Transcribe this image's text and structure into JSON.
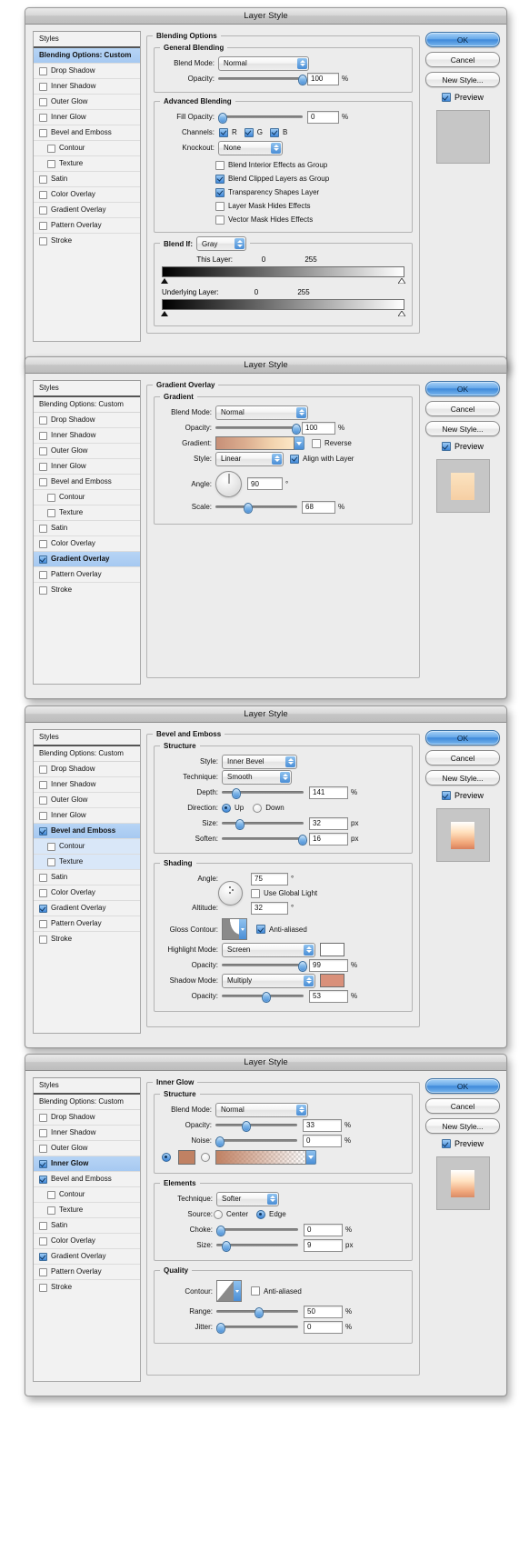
{
  "dialog_title": "Layer Style",
  "buttons": {
    "ok": "OK",
    "cancel": "Cancel",
    "new_style": "New Style...",
    "preview": "Preview"
  },
  "styles_header": "Styles",
  "styles_items": [
    "Blending Options: Custom",
    "Drop Shadow",
    "Inner Shadow",
    "Outer Glow",
    "Inner Glow",
    "Bevel and Emboss",
    "Contour",
    "Texture",
    "Satin",
    "Color Overlay",
    "Gradient Overlay",
    "Pattern Overlay",
    "Stroke"
  ],
  "colors": {
    "selection_blue": "#a9cbf2",
    "accent_blue": "#4a8ed6",
    "gradient_start": "#c79078",
    "gradient_end": "#fce7c6",
    "shadow_swatch": "#d9907a",
    "highlight_swatch": "#ffffff",
    "inner_glow_swatch": "#c08163",
    "preview_bg": "#c6c6c6"
  },
  "panel1": {
    "title": "Layer Style",
    "selected_style": "Blending Options: Custom",
    "group": "Blending Options",
    "general": {
      "legend": "General Blending",
      "blend_mode_label": "Blend Mode:",
      "blend_mode_value": "Normal",
      "opacity_label": "Opacity:",
      "opacity_value": "100",
      "opacity_unit": "%",
      "opacity_pct": 100
    },
    "advanced": {
      "legend": "Advanced Blending",
      "fill_opacity_label": "Fill Opacity:",
      "fill_opacity_value": "0",
      "fill_opacity_unit": "%",
      "fill_opacity_pct": 0,
      "channels_label": "Channels:",
      "channels": [
        {
          "label": "R",
          "checked": true
        },
        {
          "label": "G",
          "checked": true
        },
        {
          "label": "B",
          "checked": true
        }
      ],
      "knockout_label": "Knockout:",
      "knockout_value": "None",
      "checks": [
        {
          "label": "Blend Interior Effects as Group",
          "checked": false
        },
        {
          "label": "Blend Clipped Layers as Group",
          "checked": true
        },
        {
          "label": "Transparency Shapes Layer",
          "checked": true
        },
        {
          "label": "Layer Mask Hides Effects",
          "checked": false
        },
        {
          "label": "Vector Mask Hides Effects",
          "checked": false
        }
      ]
    },
    "blend_if": {
      "legend_label": "Blend If:",
      "channel_value": "Gray",
      "this_layer_label": "This Layer:",
      "this_layer_min": "0",
      "this_layer_max": "255",
      "underlying_label": "Underlying Layer:",
      "underlying_min": "0",
      "underlying_max": "255"
    }
  },
  "panel2": {
    "title": "Layer Style",
    "selected_style": "Gradient Overlay",
    "group": "Gradient Overlay",
    "gradient": {
      "legend": "Gradient",
      "blend_mode_label": "Blend Mode:",
      "blend_mode_value": "Normal",
      "opacity_label": "Opacity:",
      "opacity_value": "100",
      "opacity_unit": "%",
      "opacity_pct": 100,
      "gradient_label": "Gradient:",
      "reverse_label": "Reverse",
      "reverse_checked": false,
      "style_label": "Style:",
      "style_value": "Linear",
      "align_label": "Align with Layer",
      "align_checked": true,
      "angle_label": "Angle:",
      "angle_value": "90",
      "angle_unit": "°",
      "scale_label": "Scale:",
      "scale_value": "68",
      "scale_unit": "%",
      "scale_pct": 68
    }
  },
  "panel3": {
    "title": "Layer Style",
    "selected_style": "Bevel and Emboss",
    "group": "Bevel and Emboss",
    "structure": {
      "legend": "Structure",
      "style_label": "Style:",
      "style_value": "Inner Bevel",
      "technique_label": "Technique:",
      "technique_value": "Smooth",
      "depth_label": "Depth:",
      "depth_value": "141",
      "depth_unit": "%",
      "depth_pct": 14,
      "direction_label": "Direction:",
      "direction_up": "Up",
      "direction_down": "Down",
      "direction_selected": "Up",
      "size_label": "Size:",
      "size_value": "32",
      "size_unit": "px",
      "size_pct": 18,
      "soften_label": "Soften:",
      "soften_value": "16",
      "soften_unit": "px",
      "soften_pct": 95
    },
    "shading": {
      "legend": "Shading",
      "angle_label": "Angle:",
      "angle_value": "75",
      "angle_unit": "°",
      "use_global_light_label": "Use Global Light",
      "use_global_light_checked": false,
      "altitude_label": "Altitude:",
      "altitude_value": "32",
      "altitude_unit": "°",
      "gloss_contour_label": "Gloss Contour:",
      "anti_aliased_label": "Anti-aliased",
      "anti_aliased_checked": true,
      "highlight_mode_label": "Highlight Mode:",
      "highlight_mode_value": "Screen",
      "highlight_opacity_label": "Opacity:",
      "highlight_opacity_value": "99",
      "highlight_opacity_unit": "%",
      "highlight_opacity_pct": 96,
      "shadow_mode_label": "Shadow Mode:",
      "shadow_mode_value": "Multiply",
      "shadow_opacity_label": "Opacity:",
      "shadow_opacity_value": "53",
      "shadow_opacity_unit": "%",
      "shadow_opacity_pct": 52
    }
  },
  "panel4": {
    "title": "Layer Style",
    "selected_style": "Inner Glow",
    "group": "Inner Glow",
    "structure": {
      "legend": "Structure",
      "blend_mode_label": "Blend Mode:",
      "blend_mode_value": "Normal",
      "opacity_label": "Opacity:",
      "opacity_value": "33",
      "opacity_unit": "%",
      "opacity_pct": 33,
      "noise_label": "Noise:",
      "noise_value": "0",
      "noise_unit": "%",
      "noise_pct": 0,
      "source_color_selected": true,
      "source_gradient_selected": false
    },
    "elements": {
      "legend": "Elements",
      "technique_label": "Technique:",
      "technique_value": "Softer",
      "source_label": "Source:",
      "source_center": "Center",
      "source_edge": "Edge",
      "source_selected": "Edge",
      "choke_label": "Choke:",
      "choke_value": "0",
      "choke_unit": "%",
      "choke_pct": 0,
      "size_label": "Size:",
      "size_value": "9",
      "size_unit": "px",
      "size_pct": 7
    },
    "quality": {
      "legend": "Quality",
      "contour_label": "Contour:",
      "anti_aliased_label": "Anti-aliased",
      "anti_aliased_checked": false,
      "range_label": "Range:",
      "range_value": "50",
      "range_unit": "%",
      "range_pct": 50,
      "jitter_label": "Jitter:",
      "jitter_value": "0",
      "jitter_unit": "%",
      "jitter_pct": 0
    }
  }
}
